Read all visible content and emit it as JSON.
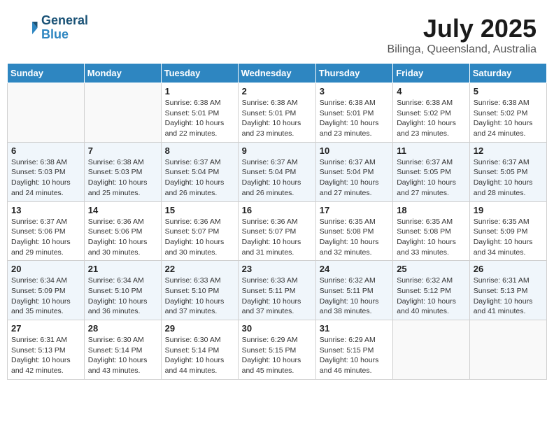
{
  "header": {
    "logo_line1": "General",
    "logo_line2": "Blue",
    "month_year": "July 2025",
    "location": "Bilinga, Queensland, Australia"
  },
  "days_of_week": [
    "Sunday",
    "Monday",
    "Tuesday",
    "Wednesday",
    "Thursday",
    "Friday",
    "Saturday"
  ],
  "weeks": [
    [
      {
        "day": "",
        "info": ""
      },
      {
        "day": "",
        "info": ""
      },
      {
        "day": "1",
        "info": "Sunrise: 6:38 AM\nSunset: 5:01 PM\nDaylight: 10 hours\nand 22 minutes."
      },
      {
        "day": "2",
        "info": "Sunrise: 6:38 AM\nSunset: 5:01 PM\nDaylight: 10 hours\nand 23 minutes."
      },
      {
        "day": "3",
        "info": "Sunrise: 6:38 AM\nSunset: 5:01 PM\nDaylight: 10 hours\nand 23 minutes."
      },
      {
        "day": "4",
        "info": "Sunrise: 6:38 AM\nSunset: 5:02 PM\nDaylight: 10 hours\nand 23 minutes."
      },
      {
        "day": "5",
        "info": "Sunrise: 6:38 AM\nSunset: 5:02 PM\nDaylight: 10 hours\nand 24 minutes."
      }
    ],
    [
      {
        "day": "6",
        "info": "Sunrise: 6:38 AM\nSunset: 5:03 PM\nDaylight: 10 hours\nand 24 minutes."
      },
      {
        "day": "7",
        "info": "Sunrise: 6:38 AM\nSunset: 5:03 PM\nDaylight: 10 hours\nand 25 minutes."
      },
      {
        "day": "8",
        "info": "Sunrise: 6:37 AM\nSunset: 5:04 PM\nDaylight: 10 hours\nand 26 minutes."
      },
      {
        "day": "9",
        "info": "Sunrise: 6:37 AM\nSunset: 5:04 PM\nDaylight: 10 hours\nand 26 minutes."
      },
      {
        "day": "10",
        "info": "Sunrise: 6:37 AM\nSunset: 5:04 PM\nDaylight: 10 hours\nand 27 minutes."
      },
      {
        "day": "11",
        "info": "Sunrise: 6:37 AM\nSunset: 5:05 PM\nDaylight: 10 hours\nand 27 minutes."
      },
      {
        "day": "12",
        "info": "Sunrise: 6:37 AM\nSunset: 5:05 PM\nDaylight: 10 hours\nand 28 minutes."
      }
    ],
    [
      {
        "day": "13",
        "info": "Sunrise: 6:37 AM\nSunset: 5:06 PM\nDaylight: 10 hours\nand 29 minutes."
      },
      {
        "day": "14",
        "info": "Sunrise: 6:36 AM\nSunset: 5:06 PM\nDaylight: 10 hours\nand 30 minutes."
      },
      {
        "day": "15",
        "info": "Sunrise: 6:36 AM\nSunset: 5:07 PM\nDaylight: 10 hours\nand 30 minutes."
      },
      {
        "day": "16",
        "info": "Sunrise: 6:36 AM\nSunset: 5:07 PM\nDaylight: 10 hours\nand 31 minutes."
      },
      {
        "day": "17",
        "info": "Sunrise: 6:35 AM\nSunset: 5:08 PM\nDaylight: 10 hours\nand 32 minutes."
      },
      {
        "day": "18",
        "info": "Sunrise: 6:35 AM\nSunset: 5:08 PM\nDaylight: 10 hours\nand 33 minutes."
      },
      {
        "day": "19",
        "info": "Sunrise: 6:35 AM\nSunset: 5:09 PM\nDaylight: 10 hours\nand 34 minutes."
      }
    ],
    [
      {
        "day": "20",
        "info": "Sunrise: 6:34 AM\nSunset: 5:09 PM\nDaylight: 10 hours\nand 35 minutes."
      },
      {
        "day": "21",
        "info": "Sunrise: 6:34 AM\nSunset: 5:10 PM\nDaylight: 10 hours\nand 36 minutes."
      },
      {
        "day": "22",
        "info": "Sunrise: 6:33 AM\nSunset: 5:10 PM\nDaylight: 10 hours\nand 37 minutes."
      },
      {
        "day": "23",
        "info": "Sunrise: 6:33 AM\nSunset: 5:11 PM\nDaylight: 10 hours\nand 37 minutes."
      },
      {
        "day": "24",
        "info": "Sunrise: 6:32 AM\nSunset: 5:11 PM\nDaylight: 10 hours\nand 38 minutes."
      },
      {
        "day": "25",
        "info": "Sunrise: 6:32 AM\nSunset: 5:12 PM\nDaylight: 10 hours\nand 40 minutes."
      },
      {
        "day": "26",
        "info": "Sunrise: 6:31 AM\nSunset: 5:13 PM\nDaylight: 10 hours\nand 41 minutes."
      }
    ],
    [
      {
        "day": "27",
        "info": "Sunrise: 6:31 AM\nSunset: 5:13 PM\nDaylight: 10 hours\nand 42 minutes."
      },
      {
        "day": "28",
        "info": "Sunrise: 6:30 AM\nSunset: 5:14 PM\nDaylight: 10 hours\nand 43 minutes."
      },
      {
        "day": "29",
        "info": "Sunrise: 6:30 AM\nSunset: 5:14 PM\nDaylight: 10 hours\nand 44 minutes."
      },
      {
        "day": "30",
        "info": "Sunrise: 6:29 AM\nSunset: 5:15 PM\nDaylight: 10 hours\nand 45 minutes."
      },
      {
        "day": "31",
        "info": "Sunrise: 6:29 AM\nSunset: 5:15 PM\nDaylight: 10 hours\nand 46 minutes."
      },
      {
        "day": "",
        "info": ""
      },
      {
        "day": "",
        "info": ""
      }
    ]
  ]
}
